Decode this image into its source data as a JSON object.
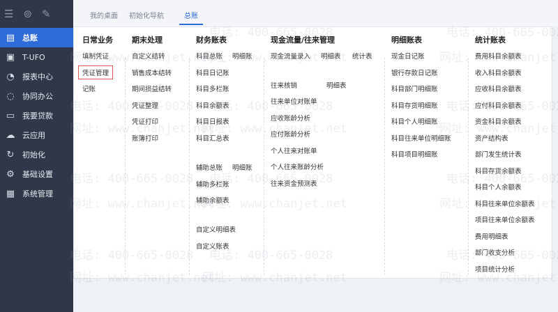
{
  "sidebar": {
    "items": [
      {
        "label": "总账",
        "icon": "ledger-icon",
        "glyph": "▤",
        "active": true
      },
      {
        "label": "T-UFO",
        "icon": "ufo-icon",
        "glyph": "▣",
        "active": false
      },
      {
        "label": "报表中心",
        "icon": "report-icon",
        "glyph": "◔",
        "active": false
      },
      {
        "label": "协同办公",
        "icon": "collaboration-icon",
        "glyph": "◌",
        "active": false
      },
      {
        "label": "我要贷款",
        "icon": "loan-icon",
        "glyph": "▭",
        "active": false
      },
      {
        "label": "云应用",
        "icon": "cloud-icon",
        "glyph": "☁",
        "active": false
      },
      {
        "label": "初始化",
        "icon": "init-icon",
        "glyph": "↻",
        "active": false
      },
      {
        "label": "基础设置",
        "icon": "settings-icon",
        "glyph": "⚙",
        "active": false
      },
      {
        "label": "系统管理",
        "icon": "system-icon",
        "glyph": "▦",
        "active": false
      }
    ]
  },
  "tabs": [
    {
      "label": "我的桌面",
      "active": false
    },
    {
      "label": "初始化导航",
      "active": false
    },
    {
      "label": "总账",
      "active": true
    }
  ],
  "menu": {
    "col1": {
      "title": "日常业务",
      "items": [
        "填制凭证",
        "凭证管理",
        "记账"
      ]
    },
    "col2": {
      "title": "期末处理",
      "items": [
        "自定义结转",
        "销售成本结转",
        "期间损益结转",
        "凭证整理",
        "凭证打印",
        "账簿打印"
      ]
    },
    "col3": {
      "title": "财务账表",
      "a": [
        "科目总账",
        "科目日记账",
        "科目多栏账",
        "科目余额表",
        "科目日报表",
        "科目汇总表"
      ],
      "a2": "明细账",
      "b": [
        "辅助总账",
        "辅助多栏账",
        "辅助余额表"
      ],
      "b2": "明细账",
      "c": [
        "自定义明细表",
        "自定义账表"
      ]
    },
    "col4": {
      "title": "现金流量/往来管理",
      "row1": [
        "现金流量录入",
        "明细表",
        "统计表"
      ],
      "sub1": "往来核销",
      "sub1b": "明细表",
      "items": [
        "往来单位对账单",
        "应收账龄分析",
        "应付账龄分析",
        "个人往来对账单",
        "个人往来账龄分析",
        "往来资金预测表"
      ]
    },
    "col5": {
      "title": "明细账表",
      "items": [
        "现金日记账",
        "银行存款日记账",
        "科目部门明细账",
        "科目存货明细账",
        "科目个人明细账",
        "科目往来单位明细账",
        "科目项目明细账"
      ]
    },
    "col6": {
      "title": "统计账表",
      "items": [
        "费用科目余额表",
        "收入科目余额表",
        "应收科目余额表",
        "应付科目余额表",
        "资金科目余额表",
        "资产结构表",
        "部门发生统计表",
        "科目存货余额表",
        "科目个人余额表",
        "科目往来单位余额表",
        "项目往来单位余额表",
        "费用明细表",
        "部门收支分析",
        "项目统计分析"
      ]
    }
  },
  "watermark": {
    "phone": "电话: 400-665-0028",
    "site": "网址: www.chanjet.net"
  }
}
